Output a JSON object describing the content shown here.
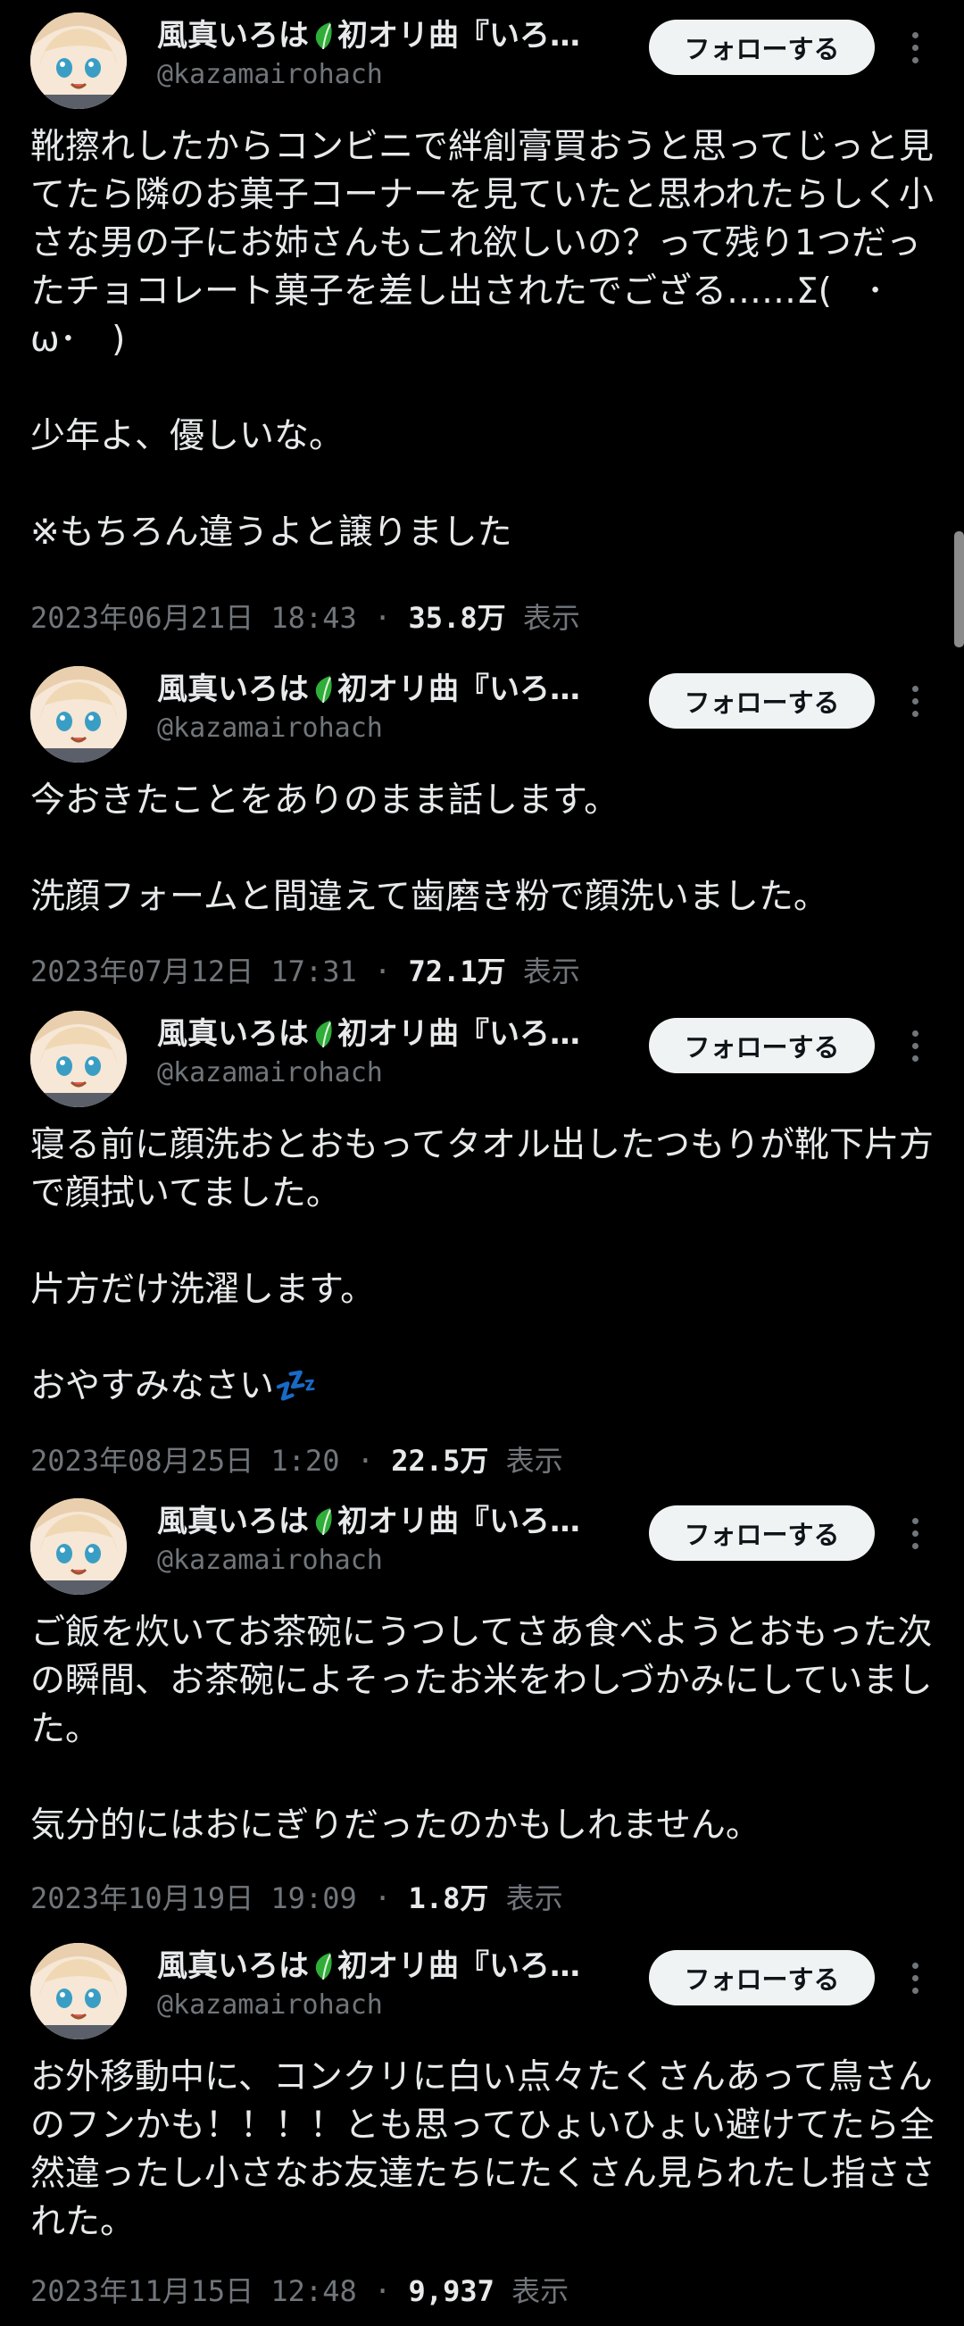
{
  "tweets": [
    {
      "name": "風真いろは🍃初オリ曲『いろ…",
      "name_prefix": "風真いろは",
      "name_suffix": "初オリ曲『いろ…",
      "handle": "@kazamairohach",
      "follow_label": "フォローする",
      "paragraphs": [
        "靴擦れしたからコンビニで絆創膏買おうと思ってじっと見てたら隣のお菓子コーナーを見ていたと思われたらしく小さな男の子にお姉さんもこれ欲しいの？って残り1つだったチョコレート菓子を差し出されたでござる……Σ(　･ω･　)",
        "少年よ、優しいな。",
        "※もちろん違うよと譲りました"
      ],
      "date": "2023年06月21日 18:43",
      "views": "35.8万",
      "views_label": "表示"
    },
    {
      "name": "風真いろは🍃初オリ曲『いろ…",
      "name_prefix": "風真いろは",
      "name_suffix": "初オリ曲『いろ…",
      "handle": "@kazamairohach",
      "follow_label": "フォローする",
      "paragraphs": [
        "今おきたことをありのまま話します。",
        "洗顔フォームと間違えて歯磨き粉で顔洗いました。"
      ],
      "date": "2023年07月12日 17:31",
      "views": "72.1万",
      "views_label": "表示"
    },
    {
      "name": "風真いろは🍃初オリ曲『いろ…",
      "name_prefix": "風真いろは",
      "name_suffix": "初オリ曲『いろ…",
      "handle": "@kazamairohach",
      "follow_label": "フォローする",
      "paragraphs": [
        "寝る前に顔洗おとおもってタオル出したつもりが靴下片方で顔拭いてました。",
        "片方だけ洗濯します。",
        "おやすみなさい💤"
      ],
      "date": "2023年08月25日 1:20",
      "views": "22.5万",
      "views_label": "表示"
    },
    {
      "name": "風真いろは🍃初オリ曲『いろ…",
      "name_prefix": "風真いろは",
      "name_suffix": "初オリ曲『いろ…",
      "handle": "@kazamairohach",
      "follow_label": "フォローする",
      "paragraphs": [
        "ご飯を炊いてお茶碗にうつしてさあ食べようとおもった次の瞬間、お茶碗によそったお米をわしづかみにしていました。",
        "気分的にはおにぎりだったのかもしれません。"
      ],
      "date": "2023年10月19日 19:09",
      "views": "1.8万",
      "views_label": "表示"
    },
    {
      "name": "風真いろは🍃初オリ曲『いろ…",
      "name_prefix": "風真いろは",
      "name_suffix": "初オリ曲『いろ…",
      "handle": "@kazamairohach",
      "follow_label": "フォローする",
      "paragraphs": [
        "お外移動中に、コンクリに白い点々たくさんあって鳥さんのフンかも！！！！とも思ってひょいひょい避けてたら全然違ったし小さなお友達たちにたくさん見られたし指さされた。"
      ],
      "date": "2023年11月15日 12:48",
      "views": "9,937",
      "views_label": "表示"
    }
  ],
  "icons": {
    "leaf": "leaf-icon",
    "more": "more-vertical-icon",
    "sleep": "zzz-icon"
  },
  "colors": {
    "background": "#000000",
    "text": "#e7e9ea",
    "secondary": "#71767b",
    "follow_bg": "#eff3f4",
    "leaf": "#2fae3a"
  }
}
